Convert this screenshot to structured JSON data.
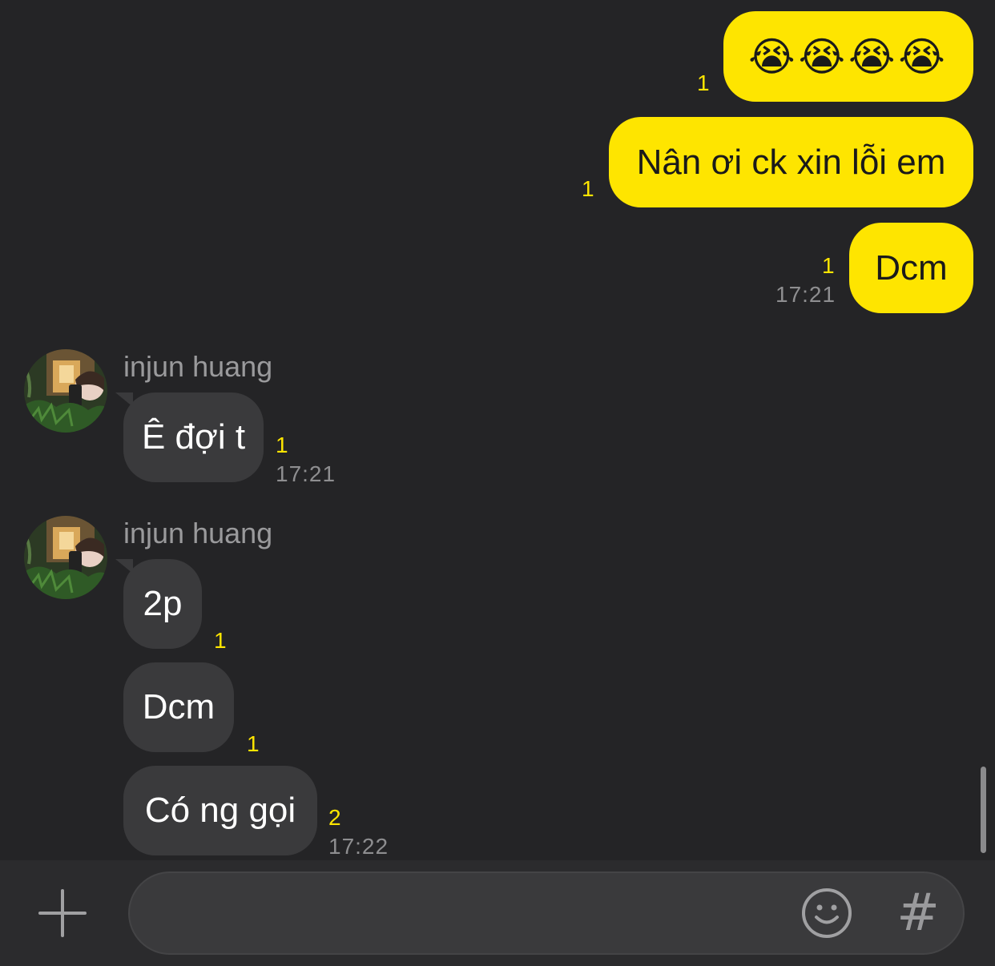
{
  "messages_outgoing": [
    {
      "text": "😭😭😭😭",
      "read_count": "1"
    },
    {
      "text": "Nân ơi ck xin lỗi em",
      "read_count": "1"
    },
    {
      "text": "Dcm",
      "read_count": "1",
      "time": "17:21"
    }
  ],
  "incoming_group_1": {
    "sender": "injun huang",
    "messages": [
      {
        "text": "Ê đợi t",
        "read_count": "1",
        "time": "17:21"
      }
    ]
  },
  "incoming_group_2": {
    "sender": "injun huang",
    "messages": [
      {
        "text": "2p",
        "read_count": "1"
      },
      {
        "text": "Dcm",
        "read_count": "1"
      },
      {
        "text": "Có ng gọi",
        "read_count": "2",
        "time": "17:22"
      }
    ]
  },
  "composer": {
    "input_value": "",
    "plus_icon": "plus-icon",
    "emoji_icon": "smiley-icon",
    "hash_label": "#"
  },
  "colors": {
    "background": "#242426",
    "outgoing_bubble": "#FEE500",
    "incoming_bubble": "#3A3A3C",
    "read_count": "#FEE500",
    "timestamp": "#8e8e90"
  }
}
